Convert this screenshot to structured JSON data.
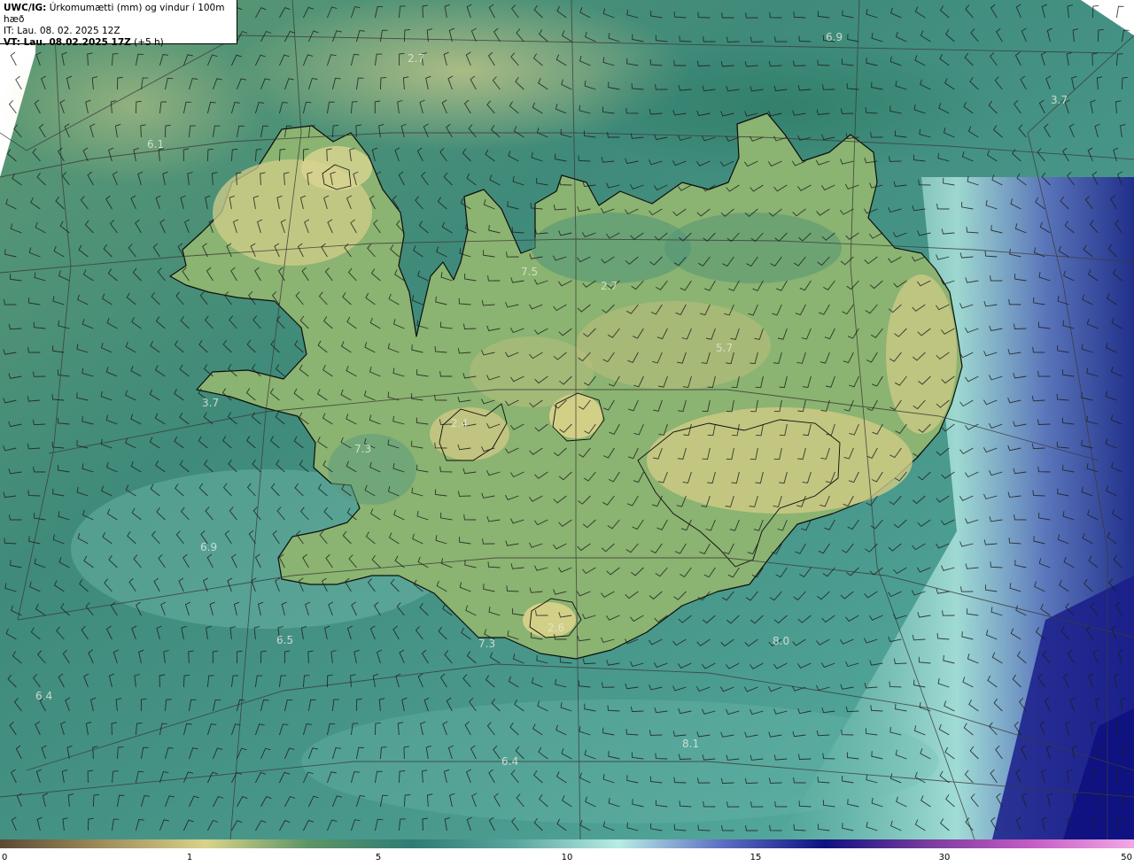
{
  "header": {
    "product": "UWC/IG:",
    "title": "Úrkomumætti (mm) og vindur í 100m hæð",
    "it_line": "IT: Lau. 08. 02. 2025 12Z",
    "vt_prefix": "VT: Lau. 08.02.2025 17Z",
    "vt_suffix": " (+5 h)"
  },
  "map": {
    "value_labels": [
      {
        "text": "2.7"
      },
      {
        "text": "6.9"
      },
      {
        "text": "3.7"
      },
      {
        "text": "6.1"
      },
      {
        "text": "7.5"
      },
      {
        "text": "2.7"
      },
      {
        "text": "5.7"
      },
      {
        "text": "3.7"
      },
      {
        "text": "2.4"
      },
      {
        "text": "7.3"
      },
      {
        "text": "6.9"
      },
      {
        "text": "6.5"
      },
      {
        "text": "7.3"
      },
      {
        "text": "2.6"
      },
      {
        "text": "8.0"
      },
      {
        "text": "6.4"
      },
      {
        "text": "8.1"
      },
      {
        "text": "6.4"
      }
    ]
  },
  "colorbar": {
    "ticks": [
      "0",
      "1",
      "5",
      "10",
      "15",
      "30",
      "50"
    ],
    "stops": [
      "#5a4a35",
      "#a08d5c",
      "#d9d38a",
      "#5c9466",
      "#2f7c75",
      "#5aa69e",
      "#b8ece6",
      "#5d6fc2",
      "#0e1180",
      "#7a3b9e",
      "#c45cc4",
      "#f3a8e6"
    ]
  },
  "colors": {
    "land_high": "#c9c783",
    "land_mid": "#7aa46a",
    "sea": "#3f8a7a",
    "sea_light": "#8fcdc4",
    "heavy": "#1a1d8a",
    "coast": "#0d0d0d",
    "barb": "#1d1d1d",
    "grid": "#3a3a3a"
  }
}
